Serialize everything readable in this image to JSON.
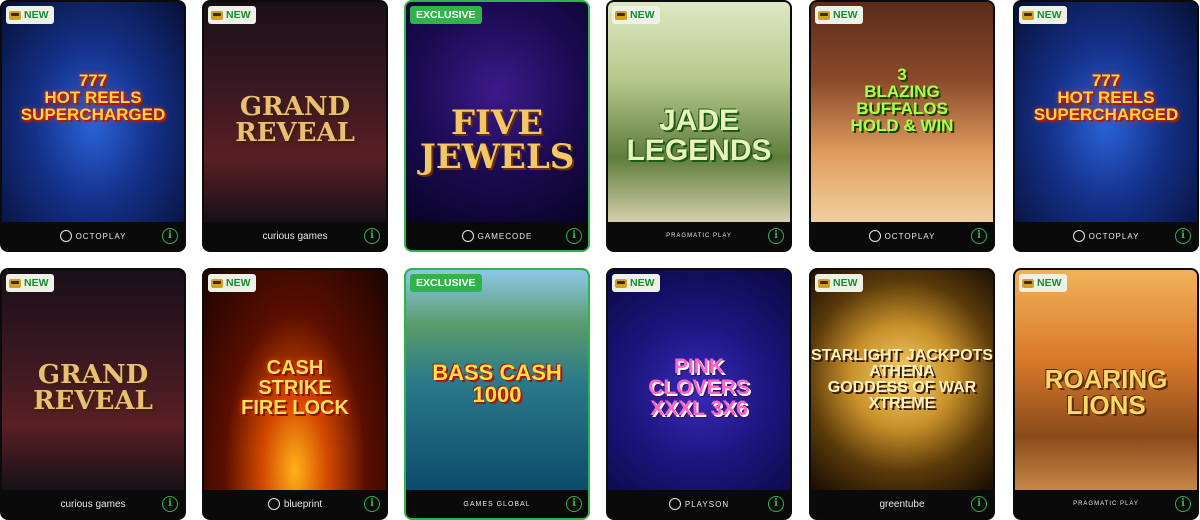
{
  "badges": {
    "new": "NEW",
    "exclusive": "EXCLUSIVE"
  },
  "info_glyph": "i",
  "games": [
    {
      "title": "777\nHOT REELS\nSUPERCHARGED",
      "provider": "OCTOPLAY",
      "badge": "NEW"
    },
    {
      "title": "GRAND\nREVEAL",
      "provider": "curious games",
      "badge": "NEW"
    },
    {
      "title": "FIVE\nJEWELS",
      "provider": "GAMECODE",
      "badge": "EXCLUSIVE"
    },
    {
      "title": "JADE\nLEGENDS",
      "provider": "PRAGMATIC PLAY",
      "badge": "NEW"
    },
    {
      "title": "3\nBLAZING\nBUFFALOS\nHOLD & WIN",
      "provider": "OCTOPLAY",
      "badge": "NEW"
    },
    {
      "title": "777\nHOT REELS\nSUPERCHARGED",
      "provider": "OCTOPLAY",
      "badge": "NEW"
    },
    {
      "title": "GRAND\nREVEAL",
      "provider": "curious games",
      "badge": "NEW"
    },
    {
      "title": "CASH\nSTRIKE\nFIRE LOCK",
      "provider": "blueprint",
      "badge": "NEW"
    },
    {
      "title": "BASS CASH\n1000",
      "provider": "GAMES GLOBAL",
      "badge": "EXCLUSIVE"
    },
    {
      "title": "PINK\nCLOVERS\nXXXL 3X6",
      "provider": "PLAYSON",
      "badge": "NEW"
    },
    {
      "title": "STARLIGHT JACKPOTS\nATHENA\nGODDESS OF WAR\nXTREME",
      "provider": "greentube",
      "badge": "NEW"
    },
    {
      "title": "ROARING\nLIONS",
      "provider": "PRAGMATIC PLAY",
      "badge": "NEW"
    }
  ]
}
